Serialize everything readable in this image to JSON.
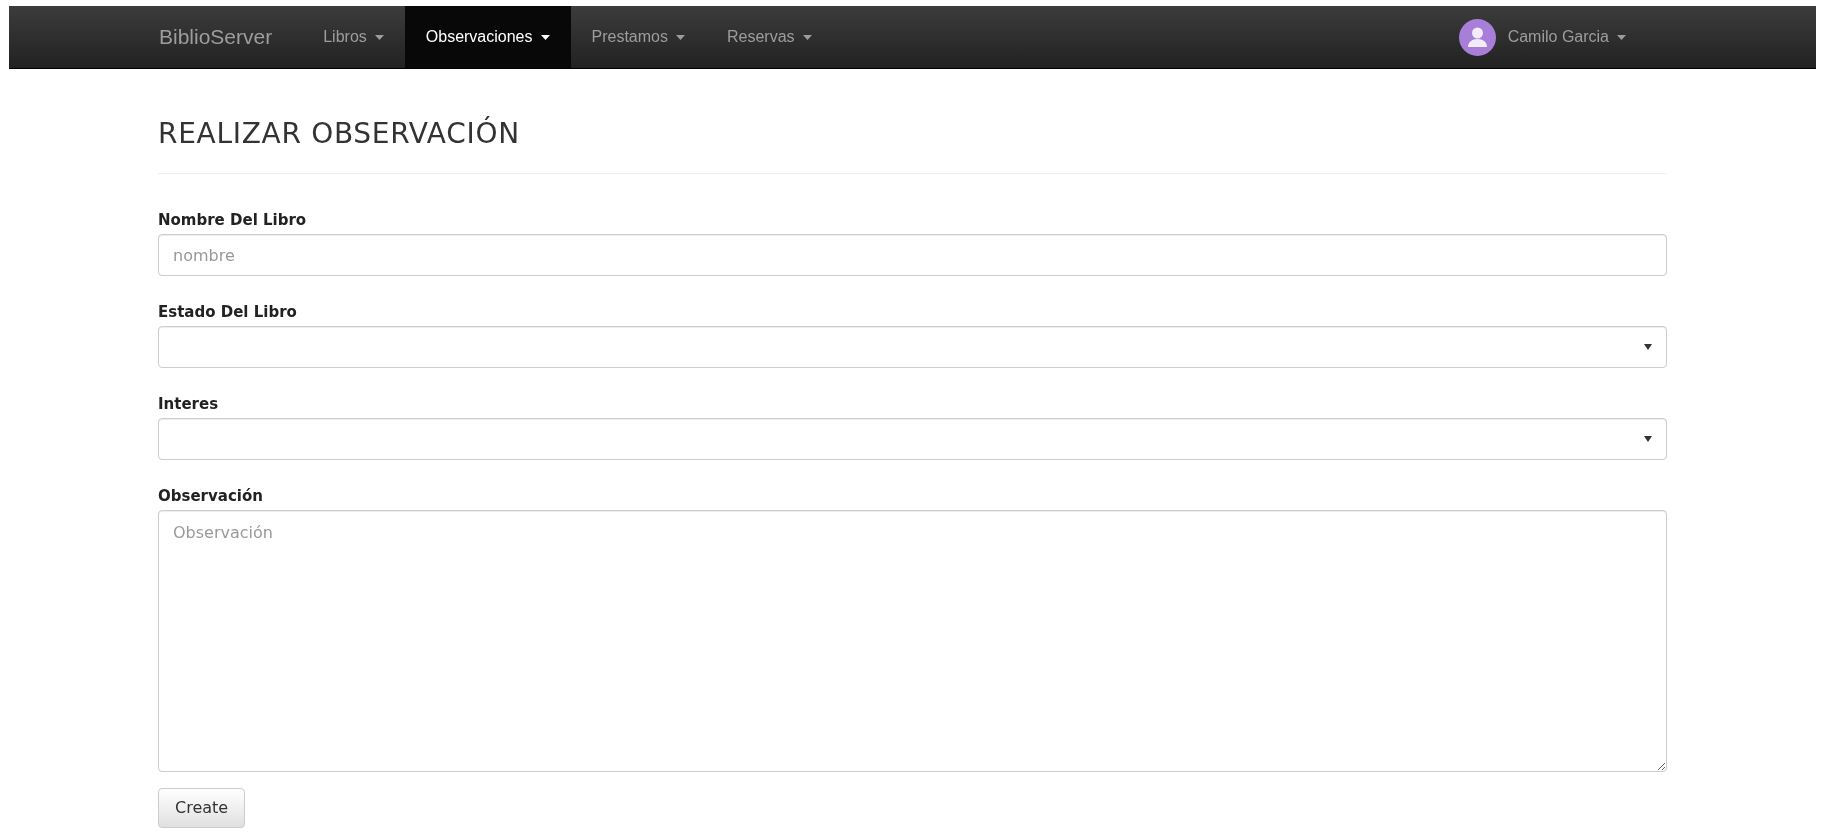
{
  "navbar": {
    "brand": "BiblioServer",
    "items": [
      {
        "label": "Libros",
        "selected": false
      },
      {
        "label": "Observaciones",
        "selected": true
      },
      {
        "label": "Prestamos",
        "selected": false
      },
      {
        "label": "Reservas",
        "selected": false
      }
    ],
    "user": {
      "name": "Camilo Garcia"
    }
  },
  "heading": "REALIZAR OBSERVACIÓN",
  "form": {
    "fields": [
      {
        "kind": "text",
        "label": "Nombre Del Libro",
        "placeholder": "nombre"
      },
      {
        "kind": "select",
        "label": "Estado Del Libro"
      },
      {
        "kind": "select",
        "label": "Interes"
      },
      {
        "kind": "textarea",
        "label": "Observación",
        "placeholder": "Observación"
      }
    ],
    "submit": "Create"
  }
}
